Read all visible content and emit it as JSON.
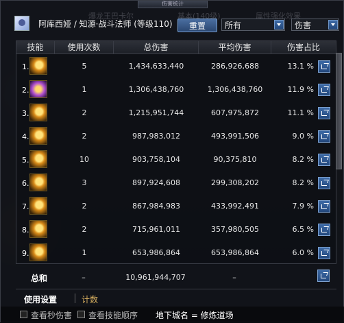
{
  "window": {
    "title": "伤害统计"
  },
  "background_ghost": {
    "boss_name": "爆龙王巴卡尔",
    "filter_left": "基本(140级)",
    "filter_right": "属性强化效果"
  },
  "header": {
    "character": "阿库西娅 / 知源·战斗法师 (等级110)",
    "reset_label": "重置",
    "filter_select": "所有",
    "type_select": "伤害"
  },
  "table": {
    "columns": [
      "技能",
      "使用次数",
      "总伤害",
      "平均伤害",
      "伤害占比"
    ],
    "rows": [
      {
        "idx": "1.",
        "icon": "flame-burst-skill-icon",
        "count": "5",
        "total": "1,434,633,440",
        "avg": "286,926,688",
        "share": "13.1 %"
      },
      {
        "idx": "2.",
        "icon": "arcane-strike-skill-icon",
        "count": "1",
        "total": "1,306,438,760",
        "avg": "1,306,438,760",
        "share": "11.9 %"
      },
      {
        "idx": "3.",
        "icon": "lightning-slash-skill-icon",
        "count": "2",
        "total": "1,215,951,744",
        "avg": "607,975,872",
        "share": "11.1 %"
      },
      {
        "idx": "4.",
        "icon": "spark-explosion-skill-icon",
        "count": "2",
        "total": "987,983,012",
        "avg": "493,991,506",
        "share": "9.0 %"
      },
      {
        "idx": "5.",
        "icon": "staff-strike-skill-icon",
        "count": "10",
        "total": "903,758,104",
        "avg": "90,375,810",
        "share": "8.2 %"
      },
      {
        "idx": "6.",
        "icon": "staff-thrust-skill-icon",
        "count": "3",
        "total": "897,924,608",
        "avg": "299,308,202",
        "share": "8.2 %"
      },
      {
        "idx": "7.",
        "icon": "golden-swing-skill-icon",
        "count": "2",
        "total": "867,984,983",
        "avg": "433,992,491",
        "share": "7.9 %"
      },
      {
        "idx": "8.",
        "icon": "vortex-skill-icon",
        "count": "2",
        "total": "715,961,011",
        "avg": "357,980,505",
        "share": "6.5 %"
      },
      {
        "idx": "9.",
        "icon": "crescent-slash-skill-icon",
        "count": "1",
        "total": "653,986,864",
        "avg": "653,986,864",
        "share": "6.0 %"
      }
    ]
  },
  "summary": {
    "label": "总和",
    "count": "–",
    "total": "10,961,944,707",
    "avg": "–"
  },
  "tabs": {
    "active": "使用设置",
    "inactive": "计数"
  },
  "footer": {
    "checkbox1": "查看秒伤害",
    "checkbox2": "查看技能顺序",
    "dungeon": "地下城名 = 修炼道场"
  },
  "colors": {
    "accent_blue": "#3d6aa6",
    "tab_gold": "#d9b060"
  }
}
